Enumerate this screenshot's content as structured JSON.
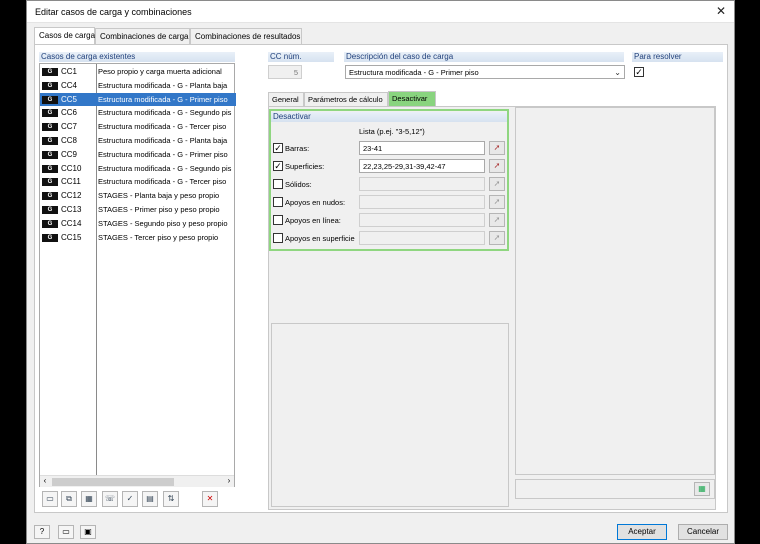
{
  "window": {
    "title": "Editar casos de carga y combinaciones"
  },
  "main_tabs": [
    {
      "label": "Casos de carga",
      "active": true
    },
    {
      "label": "Combinaciones de carga",
      "active": false
    },
    {
      "label": "Combinaciones de resultados",
      "active": false
    }
  ],
  "existing": {
    "header": "Casos de carga existentes",
    "rows": [
      {
        "badge": "G",
        "id": "CC1",
        "desc": "Peso propio y carga muerta adicional",
        "selected": false
      },
      {
        "badge": "G",
        "id": "CC4",
        "desc": "Estructura modificada - G - Planta baja",
        "selected": false
      },
      {
        "badge": "G",
        "id": "CC5",
        "desc": "Estructura modificada - G - Primer piso",
        "selected": true
      },
      {
        "badge": "G",
        "id": "CC6",
        "desc": "Estructura modificada - G - Segundo pis",
        "selected": false
      },
      {
        "badge": "G",
        "id": "CC7",
        "desc": "Estructura modificada - G - Tercer piso",
        "selected": false
      },
      {
        "badge": "G",
        "id": "CC8",
        "desc": "Estructura modificada - G - Planta baja",
        "selected": false
      },
      {
        "badge": "G",
        "id": "CC9",
        "desc": "Estructura modificada - G - Primer piso",
        "selected": false
      },
      {
        "badge": "G",
        "id": "CC10",
        "desc": "Estructura modificada - G - Segundo pis",
        "selected": false
      },
      {
        "badge": "G",
        "id": "CC11",
        "desc": "Estructura modificada - G - Tercer piso",
        "selected": false
      },
      {
        "badge": "G",
        "id": "CC12",
        "desc": "STAGES - Planta baja y peso propio",
        "selected": false
      },
      {
        "badge": "G",
        "id": "CC13",
        "desc": "STAGES - Primer piso y peso propio",
        "selected": false
      },
      {
        "badge": "G",
        "id": "CC14",
        "desc": "STAGES - Segundo piso y peso propio",
        "selected": false
      },
      {
        "badge": "G",
        "id": "CC15",
        "desc": "STAGES - Tercer piso y peso propio",
        "selected": false
      }
    ]
  },
  "cc_num": {
    "header": "CC núm.",
    "value": "5"
  },
  "description": {
    "header": "Descripción del caso de carga",
    "value": "Estructura modificada - G - Primer piso"
  },
  "to_solve": {
    "header": "Para resolver",
    "checked": true
  },
  "sub_tabs": [
    {
      "label": "General",
      "active": false
    },
    {
      "label": "Parámetros de cálculo",
      "active": false
    },
    {
      "label": "Desactivar",
      "active": true
    }
  ],
  "deactivate": {
    "header": "Desactivar",
    "list_label": "Lista (p.ej. \"3-5,12\")",
    "items": [
      {
        "label": "Barras:",
        "checked": true,
        "value": "23-41",
        "enabled": true
      },
      {
        "label": "Superficies:",
        "checked": true,
        "value": "22,23,25-29,31-39,42-47",
        "enabled": true
      },
      {
        "label": "Sólidos:",
        "checked": false,
        "value": "",
        "enabled": false
      },
      {
        "label": "Apoyos en nudos:",
        "checked": false,
        "value": "",
        "enabled": false
      },
      {
        "label": "Apoyos en línea:",
        "checked": false,
        "value": "",
        "enabled": false
      },
      {
        "label": "Apoyos en superficie",
        "checked": false,
        "value": "",
        "enabled": false
      }
    ]
  },
  "buttons": {
    "ok": "Aceptar",
    "cancel": "Cancelar"
  },
  "colors": {
    "selection": "#3277c8",
    "accent_green": "#89d47f",
    "header_text": "#1f3f7a"
  }
}
